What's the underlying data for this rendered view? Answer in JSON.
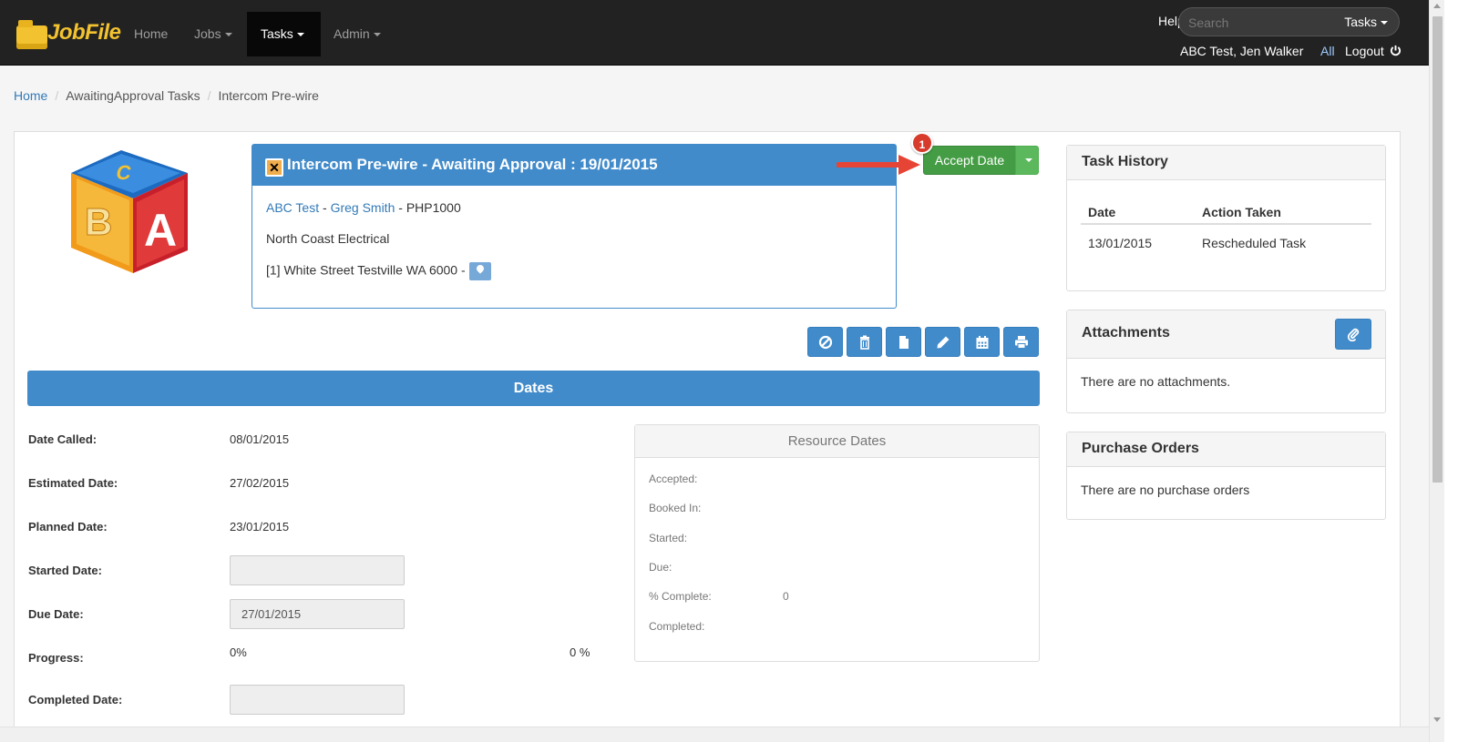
{
  "app": {
    "logo_text": "JobFile",
    "accent_color": "#428bca",
    "success_color": "#449d44"
  },
  "navbar": {
    "items": [
      {
        "label": "Home",
        "has_caret": false
      },
      {
        "label": "Jobs",
        "has_caret": true
      },
      {
        "label": "Tasks",
        "has_caret": true,
        "active": true
      },
      {
        "label": "Admin",
        "has_caret": true
      }
    ],
    "help_label": "Help",
    "search_placeholder": "Search",
    "search_scope": "Tasks",
    "user_label": "ABC Test, Jen Walker",
    "all_label": "All",
    "logout_label": "Logout"
  },
  "breadcrumb": {
    "home": "Home",
    "section": "AwaitingApproval Tasks",
    "current": "Intercom Pre-wire"
  },
  "task": {
    "title": "Intercom Pre-wire - Awaiting Approval : 19/01/2015",
    "client_link": "ABC Test",
    "contact_link": "Greg Smith",
    "job_code": "- PHP1000",
    "separator": "-",
    "company": "North Coast Electrical",
    "address": "[1] White Street Testville WA 6000 -"
  },
  "actions": {
    "accept_label": "Accept Date",
    "annotation_number": "1",
    "toolbar_icons": [
      "ban-icon",
      "trash-icon",
      "file-icon",
      "pencil-icon",
      "calendar-icon",
      "print-icon"
    ]
  },
  "dates": {
    "header": "Dates",
    "fields": {
      "date_called_label": "Date Called:",
      "date_called_value": "08/01/2015",
      "estimated_label": "Estimated Date:",
      "estimated_value": "27/02/2015",
      "planned_label": "Planned Date:",
      "planned_value": "23/01/2015",
      "started_label": "Started Date:",
      "started_value": "",
      "due_label": "Due Date:",
      "due_value": "27/01/2015",
      "progress_label": "Progress:",
      "progress_value": "0%",
      "progress_pct": "0 %",
      "completed_label": "Completed Date:",
      "completed_value": ""
    }
  },
  "resource_dates": {
    "title": "Resource Dates",
    "accepted": "Accepted:",
    "booked_in": "Booked In:",
    "started": "Started:",
    "due": "Due:",
    "pct_complete": "% Complete:",
    "pct_complete_value": "0",
    "completed": "Completed:"
  },
  "task_history": {
    "title": "Task History",
    "columns": [
      "Date",
      "Action Taken"
    ],
    "rows": [
      {
        "date": "13/01/2015",
        "action": "Rescheduled Task"
      }
    ]
  },
  "attachments": {
    "title": "Attachments",
    "empty": "There are no attachments."
  },
  "purchase_orders": {
    "title": "Purchase Orders",
    "empty": "There are no purchase orders"
  }
}
